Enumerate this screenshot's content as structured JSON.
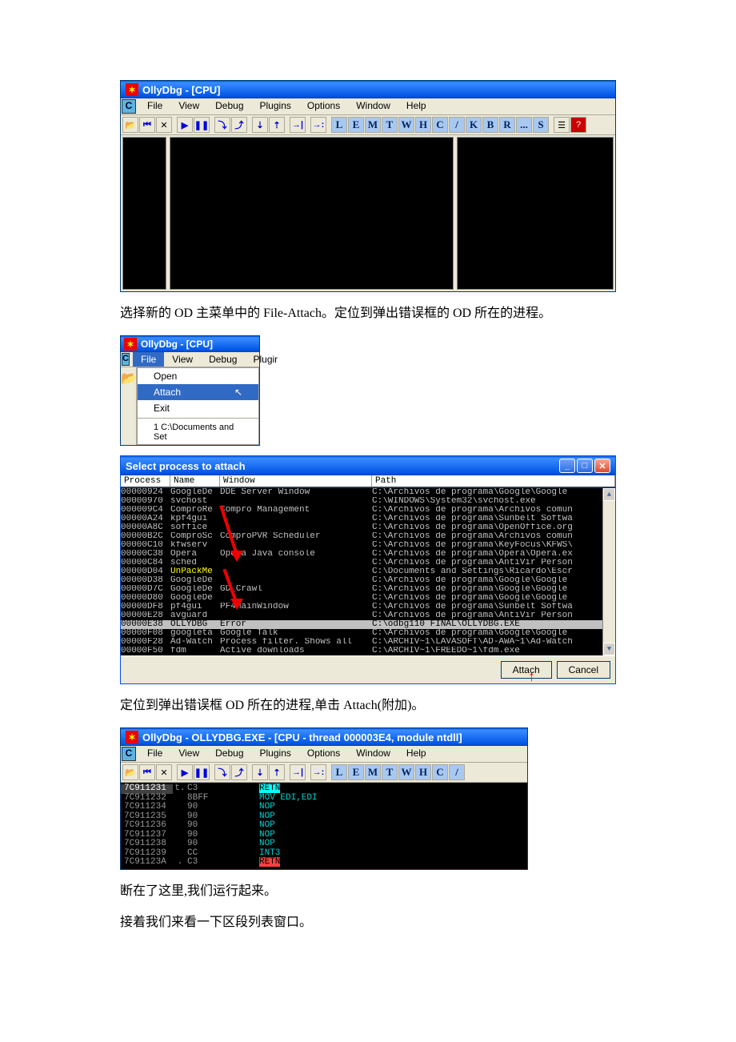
{
  "window1": {
    "title": "OllyDbg - [CPU]",
    "menu": [
      "File",
      "View",
      "Debug",
      "Plugins",
      "Options",
      "Window",
      "Help"
    ],
    "toolbar_letters": [
      "L",
      "E",
      "M",
      "T",
      "W",
      "H",
      "C",
      "/",
      "K",
      "B",
      "R",
      "...",
      "S"
    ]
  },
  "text1": "选择新的 OD 主菜单中的 File-Attach。定位到弹出错误框的 OD 所在的进程。",
  "window2": {
    "title": "OllyDbg - [CPU]",
    "menu": [
      "File",
      "View",
      "Debug",
      "Plugir"
    ],
    "dropdown": {
      "open": "Open",
      "attach": "Attach",
      "exit": "Exit",
      "recent": "1 C:\\Documents and Set"
    }
  },
  "process_window": {
    "title": "Select process to attach",
    "headers": [
      "Process",
      "Name",
      "Window",
      "Path"
    ],
    "rows": [
      {
        "p": "00000924",
        "n": "GoogleDe",
        "w": "DDE Server Window",
        "path": "C:\\Archivos de programa\\Google\\Google"
      },
      {
        "p": "00000970",
        "n": "svchost",
        "w": "",
        "path": "C:\\WINDOWS\\System32\\svchost.exe"
      },
      {
        "p": "000009C4",
        "n": "ComproRe",
        "w": "Compro Management",
        "path": "C:\\Archivos de programa\\Archivos comun"
      },
      {
        "p": "00000A24",
        "n": "kpf4gui",
        "w": "",
        "path": "C:\\Archivos de programa\\Sunbelt Softwa"
      },
      {
        "p": "00000A8C",
        "n": "soffice",
        "w": "",
        "path": "C:\\Archivos de programa\\OpenOffice.org"
      },
      {
        "p": "00000B2C",
        "n": "ComproSc",
        "w": "ComproPVR Scheduler",
        "path": "C:\\Archivos de programa\\Archivos comun"
      },
      {
        "p": "00000C10",
        "n": "kfwserv",
        "w": "",
        "path": "C:\\Archivos de programa\\KeyFocus\\KFWS\\"
      },
      {
        "p": "00000C38",
        "n": "Opera",
        "w": "Opera Java console",
        "path": "C:\\Archivos de programa\\Opera\\Opera.ex"
      },
      {
        "p": "00000C84",
        "n": "sched",
        "w": "",
        "path": "C:\\Archivos de programa\\AntiVir Person"
      },
      {
        "p": "00000D04",
        "n": "UnPackMe",
        "w": "",
        "path": "C:\\Documents and Settings\\Ricardo\\Escr"
      },
      {
        "p": "00000D38",
        "n": "GoogleDe",
        "w": "",
        "path": "C:\\Archivos de programa\\Google\\Google"
      },
      {
        "p": "00000D7C",
        "n": "GoogleDe",
        "w": "GD_Crawl",
        "path": "C:\\Archivos de programa\\Google\\Google"
      },
      {
        "p": "00000D80",
        "n": "GoogleDe",
        "w": "",
        "path": "C:\\Archivos de programa\\Google\\Google"
      },
      {
        "p": "00000DF8",
        "n": "pf4gui",
        "w": "PF4MainWindow",
        "path": "C:\\Archivos de programa\\Sunbelt Softwa"
      },
      {
        "p": "00000E28",
        "n": "avguard",
        "w": "",
        "path": "C:\\Archivos de programa\\AntiVir Person"
      },
      {
        "p": "00000E38",
        "n": "OLLYDBG",
        "w": "Error",
        "path": "C:\\odbg110 FINAL\\OLLYDBG.EXE",
        "sel": true
      },
      {
        "p": "00000F08",
        "n": "googleta",
        "w": "Google Talk",
        "path": "C:\\Archivos de programa\\Google\\Google"
      },
      {
        "p": "00000F28",
        "n": "Ad-Watch",
        "w": "Process filter. Shows all",
        "path": "C:\\ARCHIV~1\\LAVASOFT\\AD-AWA~1\\Ad-Watch"
      },
      {
        "p": "00000F50",
        "n": "fdm",
        "w": "Active downloads",
        "path": "C:\\ARCHIV~1\\FREEDO~1\\fdm.exe"
      }
    ],
    "attach_btn": "Attach",
    "cancel_btn": "Cancel"
  },
  "text2": "定位到弹出错误框 OD 所在的进程,单击 Attach(附加)。",
  "window3": {
    "title": "OllyDbg - OLLYDBG.EXE - [CPU - thread 000003E4, module ntdll]",
    "menu": [
      "File",
      "View",
      "Debug",
      "Plugins",
      "Options",
      "Window",
      "Help"
    ],
    "toolbar_letters": [
      "L",
      "E",
      "M",
      "T",
      "W",
      "H",
      "C",
      "/"
    ],
    "rows": [
      {
        "a": "7C911231",
        "m": "t.",
        "h": "C3",
        "d": "RETN",
        "hl": true
      },
      {
        "a": "7C911232",
        "m": "",
        "h": "8BFF",
        "d": "MOV EDI,EDI"
      },
      {
        "a": "7C911234",
        "m": "",
        "h": "90",
        "d": "NOP"
      },
      {
        "a": "7C911235",
        "m": "",
        "h": "90",
        "d": "NOP"
      },
      {
        "a": "7C911236",
        "m": "",
        "h": "90",
        "d": "NOP"
      },
      {
        "a": "7C911237",
        "m": "",
        "h": "90",
        "d": "NOP"
      },
      {
        "a": "7C911238",
        "m": "",
        "h": "90",
        "d": "NOP"
      },
      {
        "a": "7C911239",
        "m": "",
        "h": "CC",
        "d": "INT3"
      },
      {
        "a": "7C91123A",
        "m": ".",
        "h": "C3",
        "d": "RETN",
        "retn": true
      }
    ]
  },
  "text3": "断在了这里,我们运行起来。",
  "text4": "接着我们来看一下区段列表窗口。"
}
